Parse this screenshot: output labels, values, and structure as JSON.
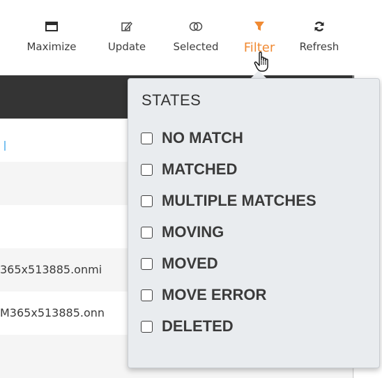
{
  "toolbar": {
    "maximize": {
      "label": "Maximize",
      "icon": "window-maximize-icon"
    },
    "update": {
      "label": "Update",
      "icon": "edit-icon"
    },
    "selected": {
      "label": "Selected",
      "icon": "toggle-icon"
    },
    "filter": {
      "label": "Filter",
      "icon": "funnel-icon",
      "color": "#f08a33"
    },
    "refresh": {
      "label": "Refresh",
      "icon": "refresh-icon"
    }
  },
  "table": {
    "rows": [
      {
        "text": ""
      },
      {
        "text": ""
      },
      {
        "text": ""
      },
      {
        "text": "365x513885.onmi"
      },
      {
        "text": "M365x513885.onn"
      },
      {
        "text": ""
      }
    ]
  },
  "filter_dropdown": {
    "title": "STATES",
    "options": [
      {
        "label": "NO MATCH",
        "checked": false
      },
      {
        "label": "MATCHED",
        "checked": false
      },
      {
        "label": "MULTIPLE MATCHES",
        "checked": false
      },
      {
        "label": "MOVING",
        "checked": false
      },
      {
        "label": "MOVED",
        "checked": false
      },
      {
        "label": "MOVE ERROR",
        "checked": false
      },
      {
        "label": "DELETED",
        "checked": false
      }
    ]
  },
  "colors": {
    "accent": "#f08a33",
    "header_bar": "#343434",
    "dropdown_bg": "#e9ecef"
  }
}
